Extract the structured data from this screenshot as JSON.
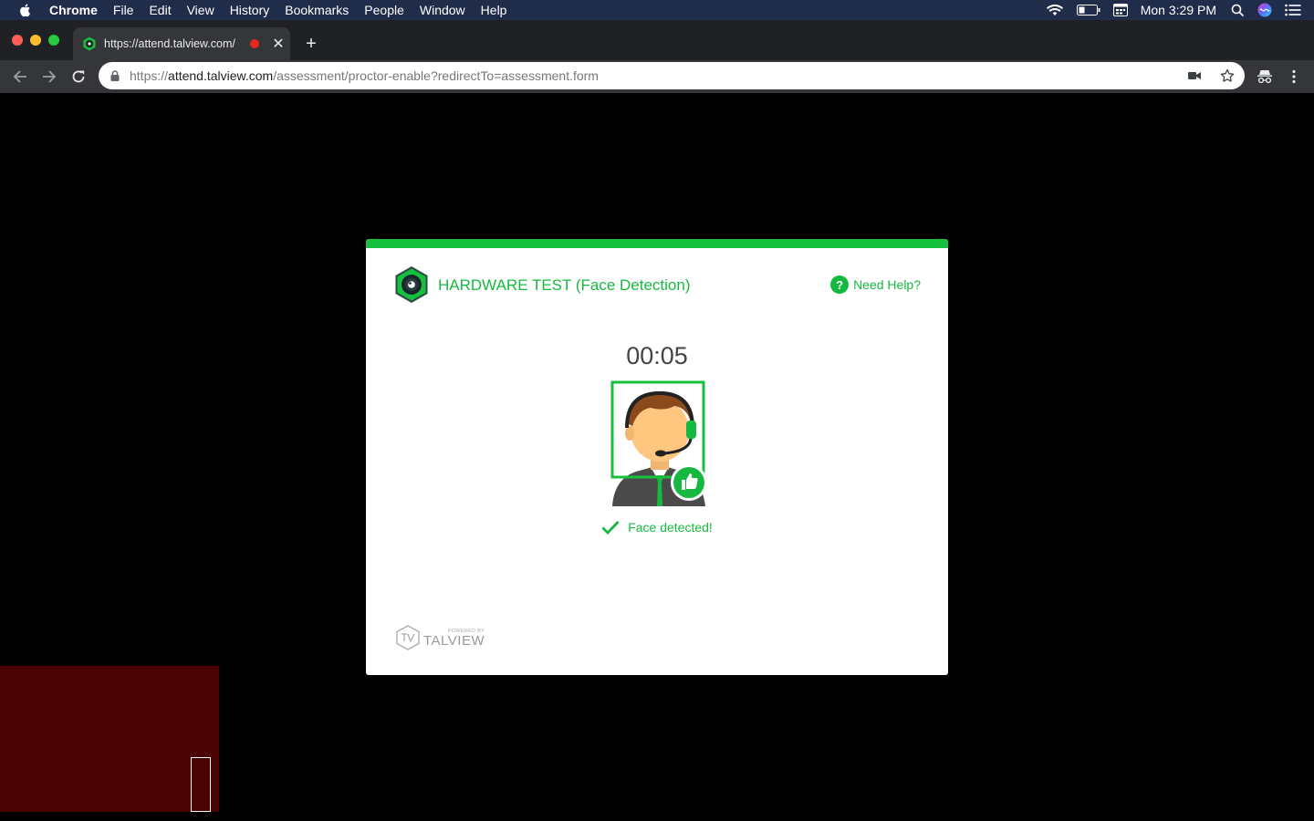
{
  "menubar": {
    "app": "Chrome",
    "items": [
      "File",
      "Edit",
      "View",
      "History",
      "Bookmarks",
      "People",
      "Window",
      "Help"
    ],
    "clock": "Mon 3:29 PM"
  },
  "tab": {
    "title": "https://attend.talview.com/"
  },
  "omnibox": {
    "scheme": "https://",
    "host": "attend.talview.com",
    "path": "/assessment/proctor-enable?redirectTo=assessment.form"
  },
  "modal": {
    "title": "HARDWARE TEST (Face Detection)",
    "help_label": "Need Help?",
    "help_icon_glyph": "?",
    "timer": "00:05",
    "status": "Face detected!",
    "powered_by": "POWERED BY",
    "brand": "TALVIEW"
  },
  "colors": {
    "accent": "#16b940",
    "menubar": "#1f2d4b",
    "tabstrip": "#202124",
    "toolbar": "#35363a",
    "webcam": "#4a0203"
  }
}
